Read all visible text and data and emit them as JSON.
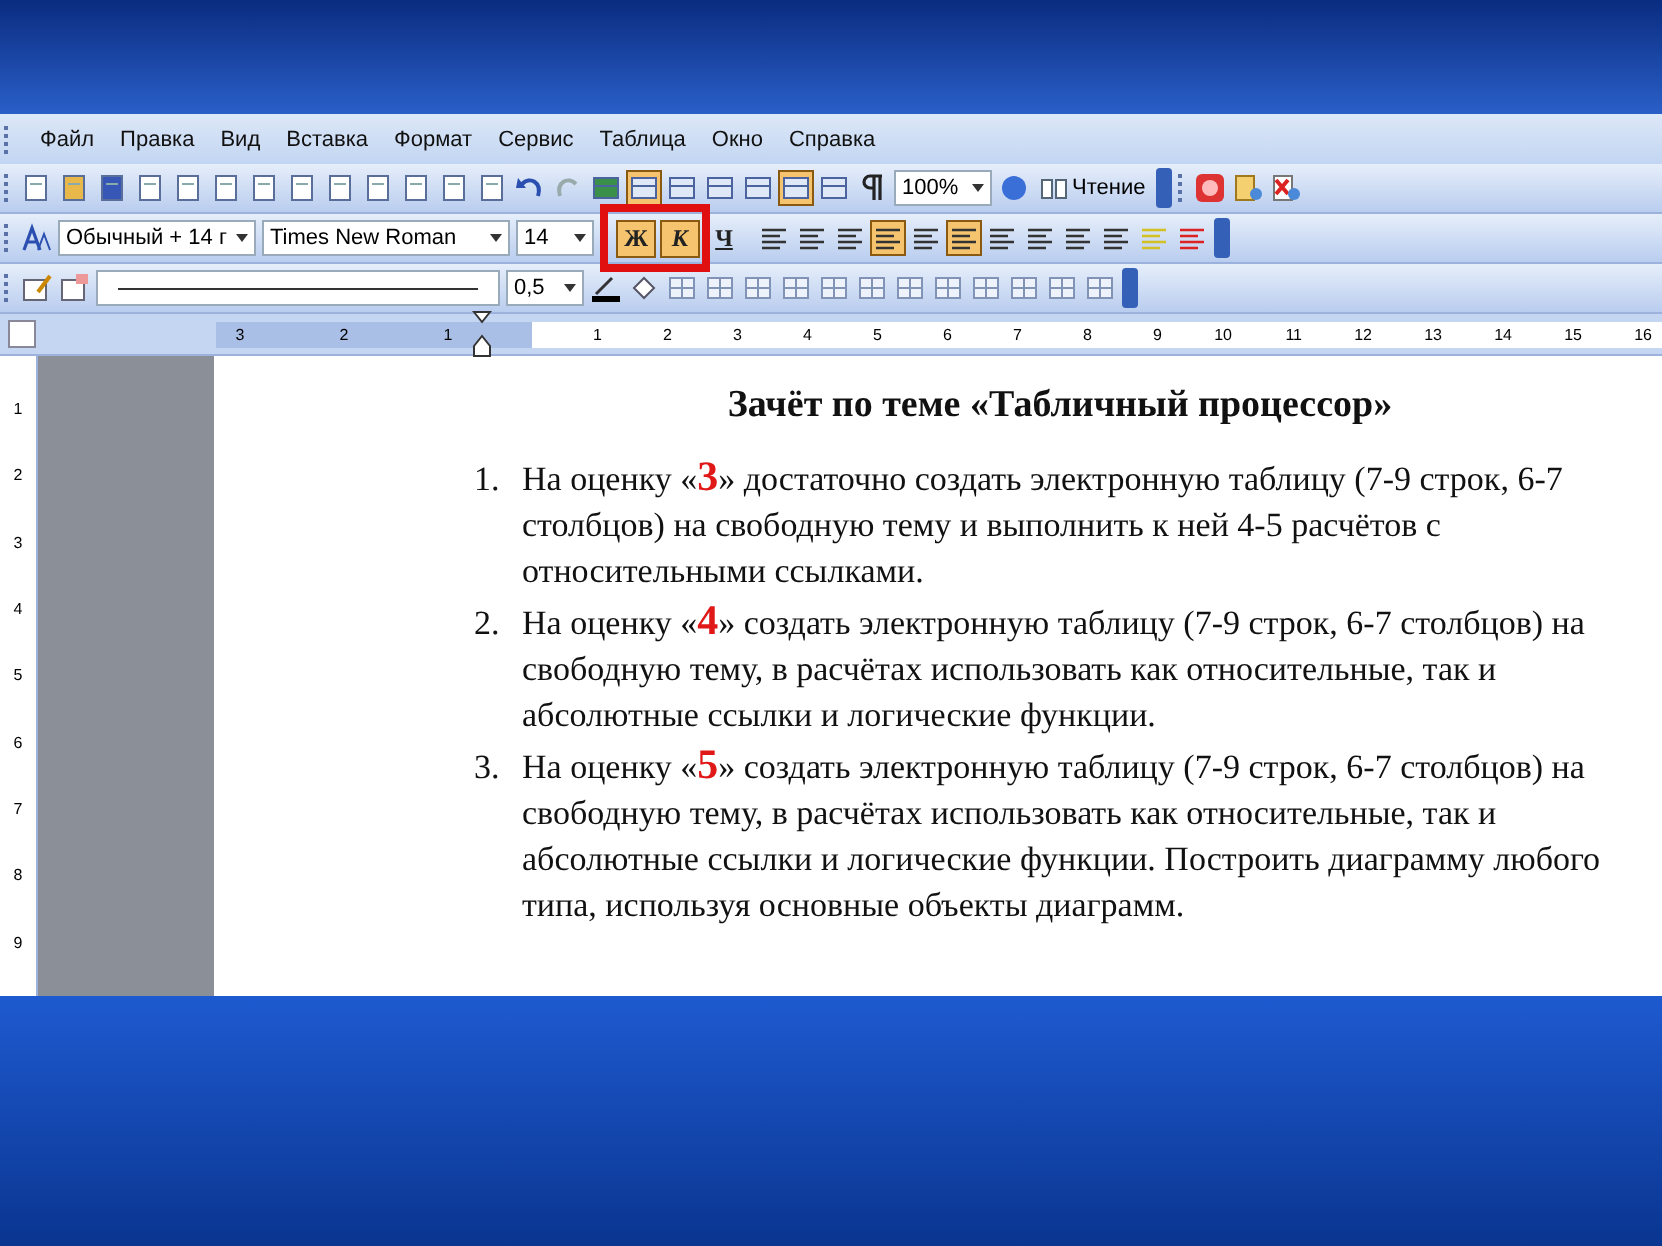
{
  "menu": [
    "Файл",
    "Правка",
    "Вид",
    "Вставка",
    "Формат",
    "Сервис",
    "Таблица",
    "Окно",
    "Справка"
  ],
  "toolbar_standard": {
    "zoom": "100%",
    "reading_button": "Чтение"
  },
  "toolbar_formatting": {
    "style": "Обычный + 14 г",
    "font": "Times New Roman",
    "size": "14",
    "font_buttons": [
      {
        "label": "Ж",
        "selected": true
      },
      {
        "label": "К",
        "selected": true
      },
      {
        "label": "Ч",
        "selected": false
      }
    ]
  },
  "toolbar_tables": {
    "line_weight": "0,5"
  },
  "ruler": {
    "left_numbers": [
      "3",
      "2",
      "1"
    ],
    "right_numbers": [
      "1",
      "2",
      "3",
      "4",
      "5",
      "6",
      "7",
      "8",
      "9",
      "10",
      "11",
      "12",
      "13",
      "14",
      "15",
      "16"
    ]
  },
  "vertical_ruler": [
    "1",
    "2",
    "3",
    "4",
    "5",
    "6",
    "7",
    "8",
    "9"
  ],
  "document": {
    "title": "Зачёт по теме «Табличный процессор»",
    "items": [
      {
        "number": "1.",
        "before": "На оценку  «",
        "grade": "3",
        "after": "» достаточно создать электронную таблицу (7-9 строк, 6-7 столбцов) на свободную тему  и выполнить к ней 4-5 расчётов с относительными ссылками."
      },
      {
        "number": "2.",
        "before": "На оценку «",
        "grade": "4",
        "after": "» создать электронную таблицу (7-9 строк, 6-7 столбцов) на свободную тему, в расчётах использовать как относительные, так и абсолютные ссылки и  логические функции."
      },
      {
        "number": "3.",
        "before": "На оценку «",
        "grade": "5",
        "after": "» создать электронную таблицу (7-9 строк, 6-7 столбцов) на свободную тему, в расчётах использовать как относительные, так и абсолютные ссылки и  логические функции. Построить  диаграмму любого типа, используя основные объекты диаграмм."
      }
    ]
  }
}
